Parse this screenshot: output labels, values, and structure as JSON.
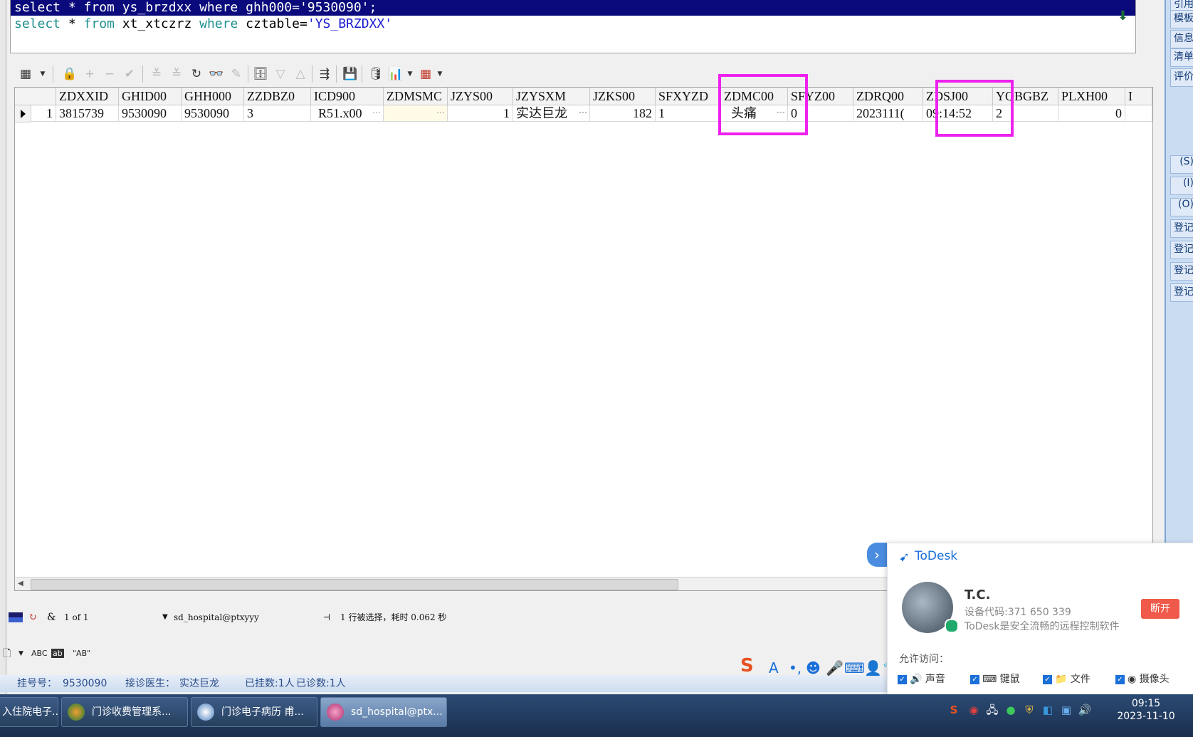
{
  "editor": {
    "line1": {
      "text": "select * from ys_brzdxx where ghh000='9530090';"
    },
    "line2": {
      "kw1": "select",
      "star": " * ",
      "kw2": "from",
      "table": " xt_xtczrz ",
      "kw3": "where",
      "cond": " cztable=",
      "str": "'YS_BRZDXX'"
    }
  },
  "grid": {
    "columns": [
      "ZDXXID",
      "GHID00",
      "GHH000",
      "ZZDBZ0",
      "ICD900",
      "ZDMSMC",
      "JZYS00",
      "JZYSXM",
      "JZKS00",
      "SFXYZD",
      "ZDMC00",
      "SFYZ00",
      "ZDRQ00",
      "ZDSJ00",
      "YQBGBZ",
      "PLXH00",
      "I"
    ],
    "row": {
      "row_no": "1",
      "cells": [
        "3815739",
        "9530090",
        "9530090",
        "3",
        "R51.x00",
        "",
        "1",
        "实达巨龙",
        "182",
        "1",
        "头痛",
        "0",
        "2023111(",
        "09:14:52",
        "2",
        "0",
        ""
      ]
    }
  },
  "grid_status": {
    "record": "1 of 1",
    "connection": "sd_hospital@ptxyyy",
    "message": "1 行被选择，耗时 0.062 秒"
  },
  "lower_bar": {
    "abc": "ABC",
    "ab_quoted": "\"AB\""
  },
  "info_line": {
    "ghh_label": "挂号号：",
    "ghh_value": "9530090",
    "doctor_label": "接诊医生：",
    "doctor_value": "实达巨龙",
    "registered": "已挂数:1人",
    "seen": "已诊数:1人"
  },
  "right_panel": [
    "引用",
    "模板",
    "信息",
    "清单",
    "评价",
    "(S)",
    "(I)",
    "(O)",
    "登记",
    "登记",
    "登记",
    "登记"
  ],
  "taskbar": {
    "tasks": [
      "入住院电子...",
      "门诊收费管理系...",
      "门诊电子病历 甫...",
      "sd_hospital@ptx..."
    ],
    "clock_time": "09:15",
    "clock_date": "2023-11-10"
  },
  "todesk": {
    "title": "ToDesk",
    "name": "T.C.",
    "device_code": "设备代码:371 650 339",
    "desc": "ToDesk是安全流畅的远程控制软件",
    "disconnect": "断开",
    "access_label": "允许访问：",
    "options": [
      "声音",
      "键鼠",
      "文件",
      "摄像头"
    ]
  },
  "colors": {
    "highlight": "#ee22ee",
    "selection": "#0a0a7c",
    "taskbar": "#1f3658",
    "todesk_blue": "#1a6fd8",
    "disconnect_red": "#f05a4a"
  }
}
